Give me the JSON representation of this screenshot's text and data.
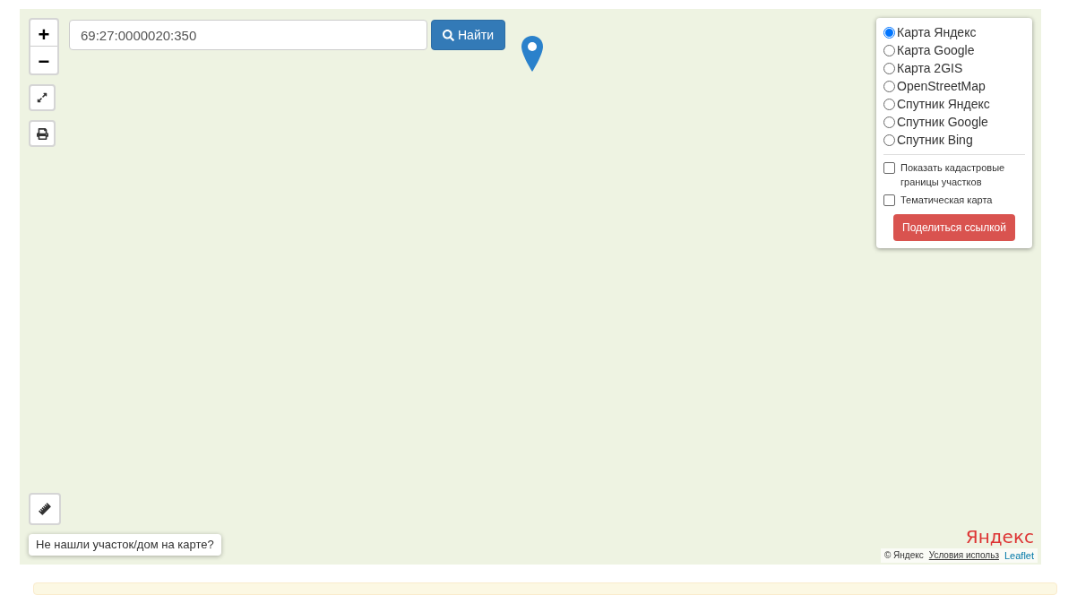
{
  "search": {
    "value": "69:27:0000020:350",
    "button": "Найти"
  },
  "zoom": {
    "in": "+",
    "out": "−"
  },
  "layers": [
    {
      "label": "Карта Яндекс",
      "selected": true
    },
    {
      "label": "Карта Google",
      "selected": false
    },
    {
      "label": "Карта 2GIS",
      "selected": false
    },
    {
      "label": "OpenStreetMap",
      "selected": false
    },
    {
      "label": "Спутник Яндекс",
      "selected": false
    },
    {
      "label": "Спутник Google",
      "selected": false
    },
    {
      "label": "Спутник Bing",
      "selected": false
    }
  ],
  "overlays": [
    {
      "label": "Показать кадастровые границы участков",
      "checked": false
    },
    {
      "label": "Тематическая карта",
      "checked": false
    }
  ],
  "share_button": "Поделиться ссылкой",
  "help_button": "Не нашли участок/дом на карте?",
  "logo": "Яндекс",
  "attribution": {
    "copyright": "© Яндекс",
    "terms": "Условия использ",
    "leaflet": "Leaflet"
  }
}
